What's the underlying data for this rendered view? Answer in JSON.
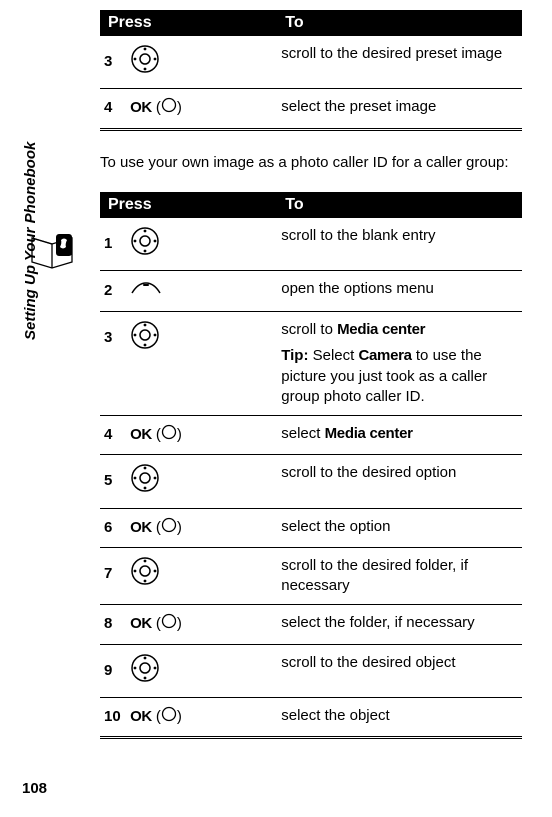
{
  "headers": {
    "press": "Press",
    "to": "To"
  },
  "table1": {
    "rows": [
      {
        "num": "3",
        "press_type": "nav",
        "to": "scroll to the desired preset image"
      },
      {
        "num": "4",
        "press_type": "ok",
        "ok_label": "OK",
        "to": "select the preset image"
      }
    ]
  },
  "instruction": "To use your own image as a photo caller ID for a caller group:",
  "table2": {
    "rows": [
      {
        "num": "1",
        "press_type": "nav",
        "to": "scroll to the blank entry"
      },
      {
        "num": "2",
        "press_type": "menu",
        "to": "open the options menu"
      },
      {
        "num": "3",
        "press_type": "nav",
        "to_prefix": "scroll to ",
        "to_bold": "Media center",
        "tip_label": "Tip:",
        "tip_prefix": " Select ",
        "tip_bold": "Camera",
        "tip_rest": " to use the picture you just took as a caller group photo caller ID."
      },
      {
        "num": "4",
        "press_type": "ok",
        "ok_label": "OK",
        "to_prefix": "select ",
        "to_bold": "Media center"
      },
      {
        "num": "5",
        "press_type": "nav",
        "to": "scroll to the desired option"
      },
      {
        "num": "6",
        "press_type": "ok",
        "ok_label": "OK",
        "to": "select the option"
      },
      {
        "num": "7",
        "press_type": "nav",
        "to": "scroll to the desired folder, if necessary"
      },
      {
        "num": "8",
        "press_type": "ok",
        "ok_label": "OK",
        "to": "select the folder, if necessary"
      },
      {
        "num": "9",
        "press_type": "nav",
        "to": "scroll to the desired object"
      },
      {
        "num": "10",
        "press_type": "ok",
        "ok_label": "OK",
        "to": "select the object"
      }
    ]
  },
  "side_tab": "Setting Up Your Phonebook",
  "page_number": "108"
}
